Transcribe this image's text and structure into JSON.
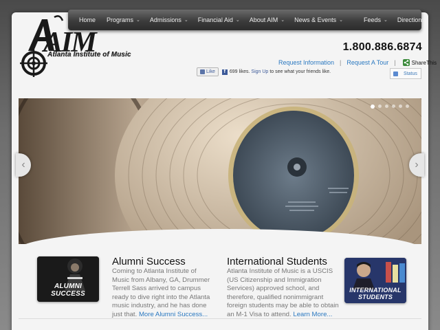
{
  "nav": {
    "items": [
      {
        "label": "Home",
        "dropdown": false
      },
      {
        "label": "Programs",
        "dropdown": true
      },
      {
        "label": "Admissions",
        "dropdown": true
      },
      {
        "label": "Financial Aid",
        "dropdown": true
      },
      {
        "label": "About AIM",
        "dropdown": true
      },
      {
        "label": "News & Events",
        "dropdown": true
      }
    ],
    "right_items": [
      {
        "label": "Feeds",
        "dropdown": true
      },
      {
        "label": "Directions",
        "dropdown": false
      }
    ],
    "chevron": "⌄"
  },
  "logo": {
    "mark": "AIM",
    "name": "Atlanta Institute of Music"
  },
  "header": {
    "phone": "1.800.886.6874",
    "links": {
      "request_info": "Request Information",
      "request_tour": "Request A Tour",
      "share": "ShareThis",
      "sep": "|"
    },
    "facebook": {
      "like": "Like",
      "count_text": "699 likes.",
      "signup": "Sign Up",
      "suffix": "to see what your friends like.",
      "fb_glyph": "f"
    },
    "status": "Status"
  },
  "slider": {
    "dot_count": 6,
    "active_dot": 0,
    "prev_glyph": "‹",
    "next_glyph": "›"
  },
  "features": {
    "alumni": {
      "image_caption": "ALUMNI SUCCESS",
      "title": "Alumni Success",
      "body": "Coming to Atlanta Institute of Music from Albany, GA, Drummer Terrell Sass arrived to campus ready to dive right into the Atlanta music industry, and he has done just that.",
      "link": "More Alumni Success..."
    },
    "international": {
      "image_caption_1": "INTERNATIONAL",
      "image_caption_2": "STUDENTS",
      "title": "International Students",
      "body": "Atlanta Institute of Music is a USCIS (US Citizenship and Immigration Services) approved school, and therefore, qualified nonimmigrant foreign students may be able to obtain an M-1 Visa to attend.",
      "link": "Learn More..."
    }
  },
  "colors": {
    "link": "#2a78c0",
    "nav_bg": "#3c3c3c",
    "facebook": "#3b5998"
  }
}
